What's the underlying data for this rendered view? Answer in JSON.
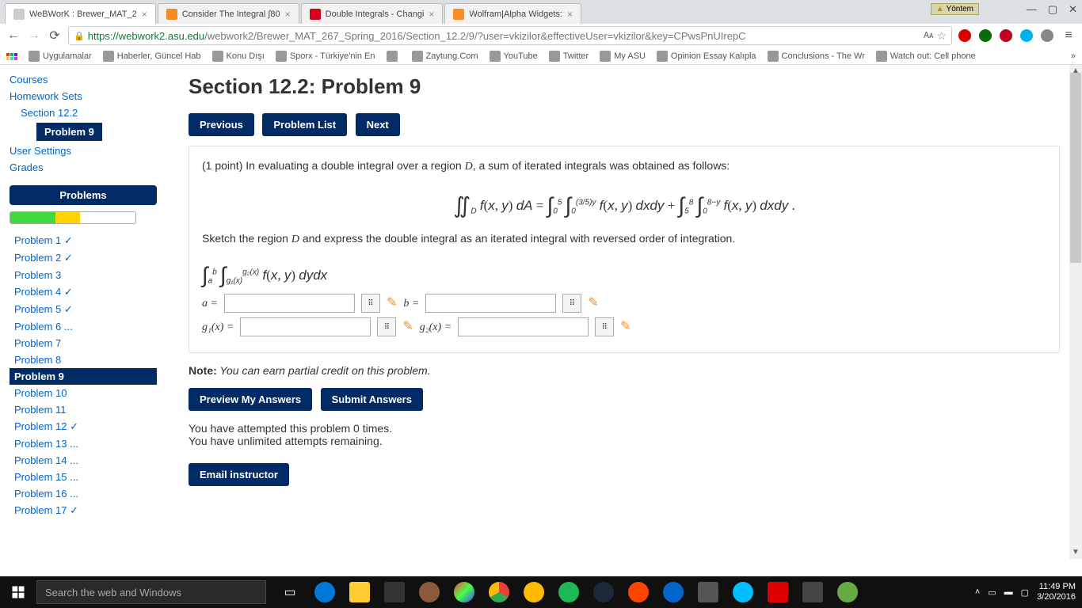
{
  "browser": {
    "tabs": [
      {
        "title": "WeBWorK : Brewer_MAT_2",
        "favclass": ""
      },
      {
        "title": "Consider The Integral ∫80",
        "favclass": "c"
      },
      {
        "title": "Double Integrals - Changi",
        "favclass": "y"
      },
      {
        "title": "Wolfram|Alpha Widgets:",
        "favclass": "w"
      }
    ],
    "yontem": "Yöntem",
    "url_host": "https://webwork2.asu.edu",
    "url_path": "/webwork2/Brewer_MAT_267_Spring_2016/Section_12.2/9/?user=vkizilor&effectiveUser=vkizilor&key=CPwsPnUIrepC",
    "bookmarks": [
      "Uygulamalar",
      "Haberler, Güncel Hab",
      "Konu Dışı",
      "Sporx - Türkiye'nin En",
      "",
      "Zaytung.Com",
      "YouTube",
      "Twitter",
      "My ASU",
      "Opinion Essay Kalıpla",
      "Conclusions - The Wr",
      "Watch out: Cell phone"
    ]
  },
  "sidebar": {
    "links": [
      "Courses",
      "Homework Sets"
    ],
    "section": "Section 12.2",
    "active": "Problem 9",
    "links2": [
      "User Settings",
      "Grades"
    ],
    "problems_header": "Problems",
    "problems": [
      {
        "label": "Problem 1",
        "state": "done"
      },
      {
        "label": "Problem 2",
        "state": "done"
      },
      {
        "label": "Problem 3",
        "state": ""
      },
      {
        "label": "Problem 4",
        "state": "done"
      },
      {
        "label": "Problem 5",
        "state": "done"
      },
      {
        "label": "Problem 6",
        "state": "dots"
      },
      {
        "label": "Problem 7",
        "state": ""
      },
      {
        "label": "Problem 8",
        "state": ""
      },
      {
        "label": "Problem 9",
        "state": "current"
      },
      {
        "label": "Problem 10",
        "state": ""
      },
      {
        "label": "Problem 11",
        "state": ""
      },
      {
        "label": "Problem 12",
        "state": "done"
      },
      {
        "label": "Problem 13",
        "state": "dots"
      },
      {
        "label": "Problem 14",
        "state": "dots"
      },
      {
        "label": "Problem 15",
        "state": "dots"
      },
      {
        "label": "Problem 16",
        "state": "dots"
      },
      {
        "label": "Problem 17",
        "state": "done"
      }
    ]
  },
  "main": {
    "title": "Section 12.2: Problem 9",
    "btn_prev": "Previous",
    "btn_list": "Problem List",
    "btn_next": "Next",
    "intro": "(1 point) In evaluating a double integral over a region ",
    "intro_D": "D",
    "intro2": ", a sum of iterated integrals was obtained as follows:",
    "sketch": "Sketch the region ",
    "sketch2": " and express the double integral as an iterated integral with reversed order of integration.",
    "lbl_a": "a =",
    "lbl_b": "b =",
    "lbl_g1": "g₁(x) =",
    "lbl_g2": "g₂(x) =",
    "note_b": "Note:",
    "note_i": " You can earn partial credit on this problem.",
    "btn_preview": "Preview My Answers",
    "btn_submit": "Submit Answers",
    "attempt1": "You have attempted this problem 0 times.",
    "attempt2": "You have unlimited attempts remaining.",
    "btn_email": "Email instructor"
  },
  "taskbar": {
    "search": "Search the web and Windows",
    "time": "11:49 PM",
    "date": "3/20/2016"
  }
}
